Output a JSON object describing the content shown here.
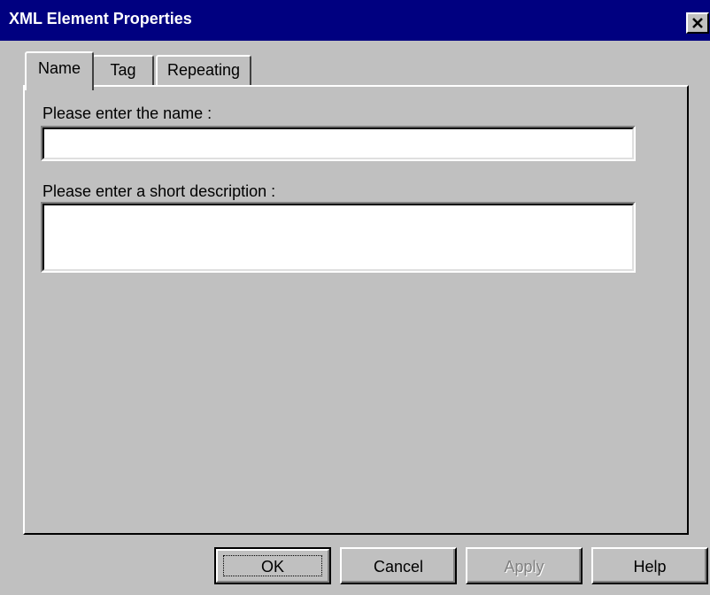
{
  "window": {
    "title": "XML Element Properties",
    "close_icon": "close-icon"
  },
  "tabs": [
    {
      "label": "Name",
      "selected": true
    },
    {
      "label": "Tag",
      "selected": false
    },
    {
      "label": "Repeating",
      "selected": false
    }
  ],
  "name_tab": {
    "name_label": "Please enter the name :",
    "name_value": "",
    "description_label": "Please enter a short description :",
    "description_value": ""
  },
  "buttons": {
    "ok": "OK",
    "cancel": "Cancel",
    "apply": "Apply",
    "help": "Help"
  },
  "colors": {
    "titlebar": "#000080",
    "face": "#c0c0c0",
    "disabled_text": "#808080"
  }
}
